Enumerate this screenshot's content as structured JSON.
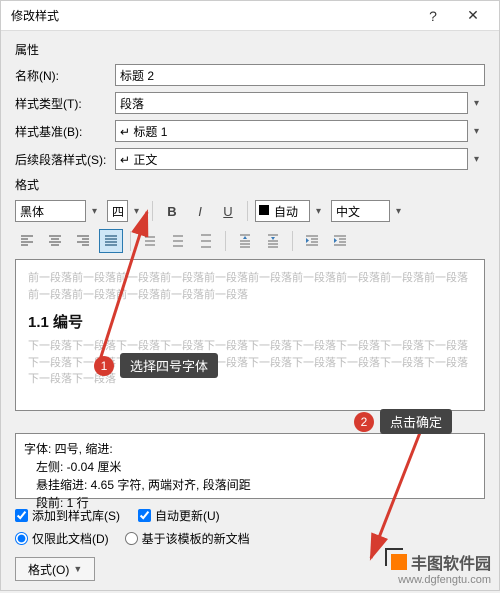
{
  "titlebar": {
    "title": "修改样式"
  },
  "sections": {
    "props": "属性",
    "format": "格式"
  },
  "fields": {
    "name": {
      "label": "名称(N):",
      "value": "标题 2"
    },
    "styleType": {
      "label": "样式类型(T):",
      "value": "段落"
    },
    "styleBase": {
      "label": "样式基准(B):",
      "value": "↵ 标题 1"
    },
    "nextStyle": {
      "label": "后续段落样式(S):",
      "value": "↵ 正文"
    }
  },
  "toolbar1": {
    "font": "黑体",
    "size": "四号",
    "auto": "自动",
    "lang": "中文"
  },
  "preview": {
    "dim1": "前一段落前一段落前一段落前一段落前一段落前一段落前一段落前一段落前一段落前一段落前一段落前一段落前一段落前一段落前一段落",
    "heading": "1.1 编号",
    "dim2": "下一段落下一段落下一段落下一段落下一段落下一段落下一段落下一段落下一段落下一段落下一段落下一段落下一段落下一段落下一段落下一段落下一段落下一段落下一段落下一段落下一段落下一段落"
  },
  "desc": {
    "line1": "字体: 四号, 缩进:",
    "line2": "左侧:  -0.04 厘米",
    "line3": "悬挂缩进: 4.65 字符, 两端对齐, 段落间距",
    "line4": "段前: 1 行"
  },
  "checks": {
    "addToGallery": "添加到样式库(S)",
    "autoUpdate": "自动更新(U)"
  },
  "radios": {
    "thisDoc": "仅限此文档(D)",
    "template": "基于该模板的新文档"
  },
  "footer": {
    "formatBtn": "格式(O)"
  },
  "callouts": {
    "c1": "选择四号字体",
    "c2": "点击确定"
  },
  "watermark": {
    "brand": "丰图软件园",
    "url": "www.dgfengtu.com"
  }
}
